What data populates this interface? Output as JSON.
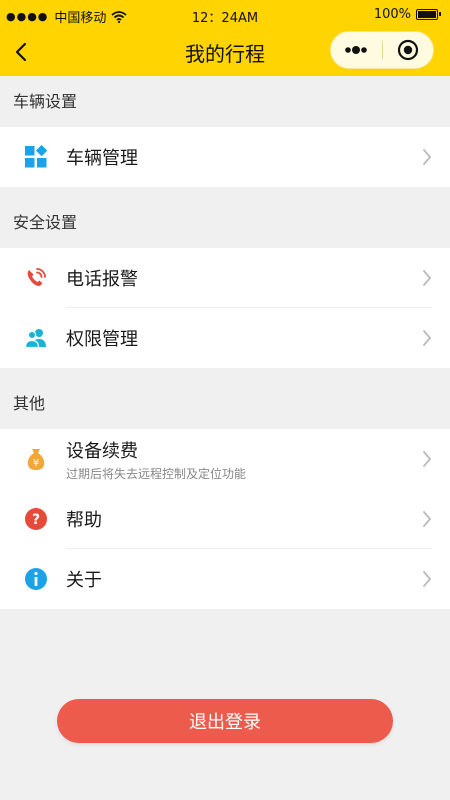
{
  "status_bar": {
    "carrier": "中国移动",
    "time": "12：24AM",
    "battery": "100%"
  },
  "nav": {
    "title": "我的行程",
    "back_icon": "back-chevron-icon",
    "more_icon": "more-dots-icon",
    "close_icon": "target-close-icon"
  },
  "sections": [
    {
      "header": "车辆设置",
      "items": [
        {
          "label": "车辆管理",
          "icon": "grid-icon",
          "color": "#1aa3e6"
        }
      ]
    },
    {
      "header": "安全设置",
      "items": [
        {
          "label": "电话报警",
          "icon": "phone-alarm-icon",
          "color": "#e64a3b"
        },
        {
          "label": "权限管理",
          "icon": "users-icon",
          "color": "#18b2d6"
        }
      ]
    },
    {
      "header": "其他",
      "items": [
        {
          "label": "设备续费",
          "sub": "过期后将失去远程控制及定位功能",
          "icon": "money-bag-icon",
          "color": "#f0a83a"
        },
        {
          "label": "帮助",
          "icon": "help-icon",
          "color": "#e64a3b"
        },
        {
          "label": "关于",
          "icon": "info-icon",
          "color": "#1aa3e6"
        }
      ]
    }
  ],
  "logout": {
    "label": "退出登录",
    "color": "#ec5b4b"
  },
  "colors": {
    "accent": "#ffd400"
  }
}
